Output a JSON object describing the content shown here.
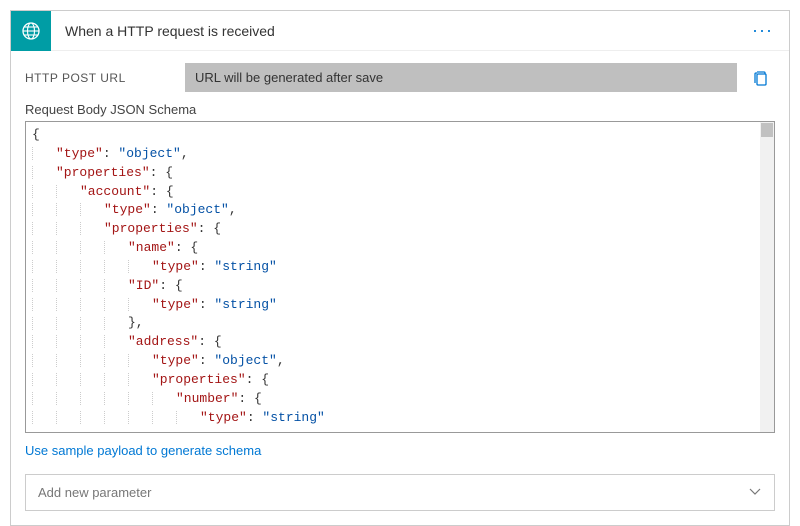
{
  "header": {
    "title": "When a HTTP request is received",
    "icon": "globe-network-icon",
    "menu_label": "···"
  },
  "url_section": {
    "label": "HTTP POST URL",
    "value": "URL will be generated after save"
  },
  "schema_section": {
    "label": "Request Body JSON Schema",
    "sample_link": "Use sample payload to generate schema",
    "lines": [
      {
        "indent": 0,
        "raw": "{"
      },
      {
        "indent": 1,
        "key": "type",
        "val": "object",
        "comma": true
      },
      {
        "indent": 1,
        "key": "properties",
        "brace": "{"
      },
      {
        "indent": 2,
        "key": "account",
        "brace": "{"
      },
      {
        "indent": 3,
        "key": "type",
        "val": "object",
        "comma": true
      },
      {
        "indent": 3,
        "key": "properties",
        "brace": "{"
      },
      {
        "indent": 4,
        "key": "name",
        "brace": "{"
      },
      {
        "indent": 5,
        "key": "type",
        "val": "string"
      },
      {
        "indent": 4,
        "key": "ID",
        "brace": "{"
      },
      {
        "indent": 5,
        "key": "type",
        "val": "string"
      },
      {
        "indent": 4,
        "raw": "},"
      },
      {
        "indent": 4,
        "key": "address",
        "brace": "{"
      },
      {
        "indent": 5,
        "key": "type",
        "val": "object",
        "comma": true
      },
      {
        "indent": 5,
        "key": "properties",
        "brace": "{"
      },
      {
        "indent": 6,
        "key": "number",
        "brace": "{"
      },
      {
        "indent": 7,
        "key": "type",
        "val": "string"
      }
    ]
  },
  "param_select": {
    "placeholder": "Add new parameter"
  }
}
